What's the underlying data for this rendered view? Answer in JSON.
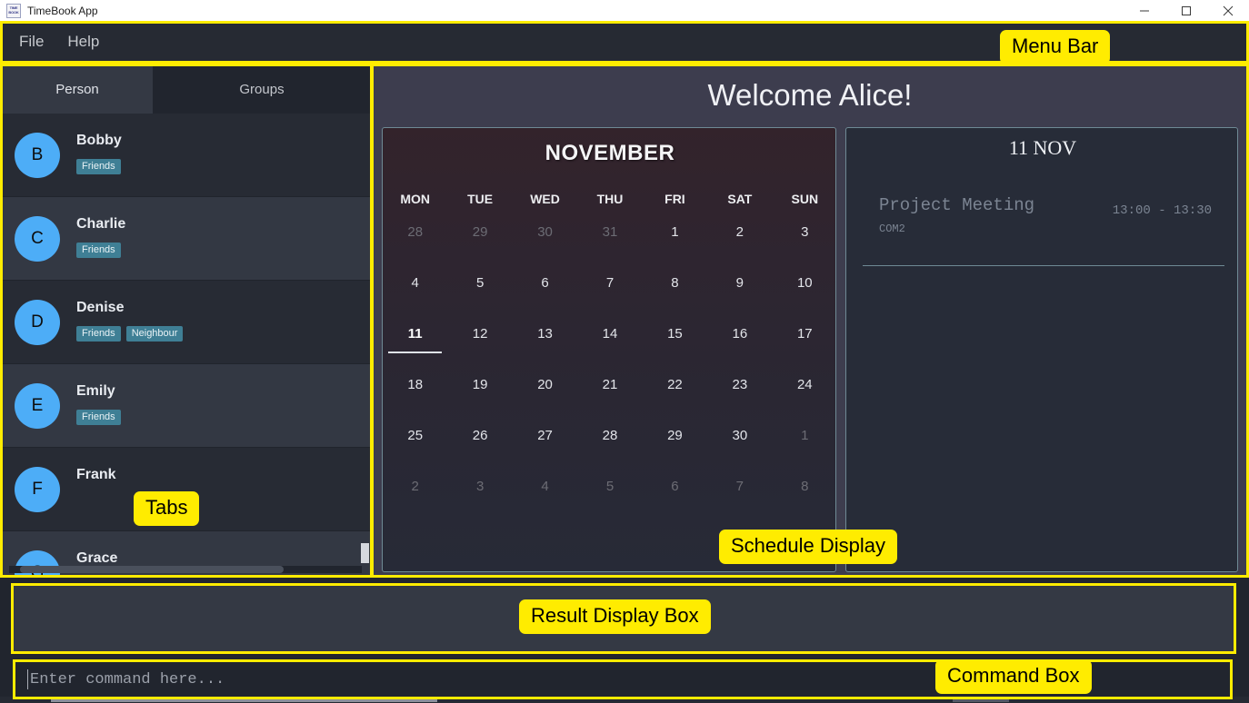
{
  "window": {
    "title": "TimeBook App",
    "icon_line1": "TIME",
    "icon_line2": "BOOK",
    "controls": {
      "minimize": "minimize-icon",
      "maximize": "maximize-icon",
      "close": "close-icon"
    }
  },
  "menubar": {
    "items": [
      {
        "label": "File"
      },
      {
        "label": "Help"
      }
    ]
  },
  "tabs": {
    "items": [
      {
        "label": "Person",
        "active": true
      },
      {
        "label": "Groups",
        "active": false
      }
    ]
  },
  "person_list": [
    {
      "initial": "B",
      "name": "Bobby",
      "tags": [
        "Friends"
      ]
    },
    {
      "initial": "C",
      "name": "Charlie",
      "tags": [
        "Friends"
      ]
    },
    {
      "initial": "D",
      "name": "Denise",
      "tags": [
        "Friends",
        "Neighbour"
      ]
    },
    {
      "initial": "E",
      "name": "Emily",
      "tags": [
        "Friends"
      ]
    },
    {
      "initial": "F",
      "name": "Frank",
      "tags": []
    },
    {
      "initial": "G",
      "name": "Grace",
      "tags": []
    }
  ],
  "main": {
    "welcome": "Welcome Alice!"
  },
  "calendar": {
    "month": "NOVEMBER",
    "day_headers": [
      "MON",
      "TUE",
      "WED",
      "THU",
      "FRI",
      "SAT",
      "SUN"
    ],
    "selected_day": 11,
    "weeks": [
      [
        {
          "d": "28",
          "o": true
        },
        {
          "d": "29",
          "o": true
        },
        {
          "d": "30",
          "o": true
        },
        {
          "d": "31",
          "o": true
        },
        {
          "d": "1",
          "o": false
        },
        {
          "d": "2",
          "o": false
        },
        {
          "d": "3",
          "o": false
        }
      ],
      [
        {
          "d": "4",
          "o": false
        },
        {
          "d": "5",
          "o": false
        },
        {
          "d": "6",
          "o": false
        },
        {
          "d": "7",
          "o": false
        },
        {
          "d": "8",
          "o": false
        },
        {
          "d": "9",
          "o": false
        },
        {
          "d": "10",
          "o": false
        }
      ],
      [
        {
          "d": "11",
          "o": false,
          "sel": true
        },
        {
          "d": "12",
          "o": false
        },
        {
          "d": "13",
          "o": false
        },
        {
          "d": "14",
          "o": false
        },
        {
          "d": "15",
          "o": false
        },
        {
          "d": "16",
          "o": false
        },
        {
          "d": "17",
          "o": false
        }
      ],
      [
        {
          "d": "18",
          "o": false
        },
        {
          "d": "19",
          "o": false
        },
        {
          "d": "20",
          "o": false
        },
        {
          "d": "21",
          "o": false
        },
        {
          "d": "22",
          "o": false
        },
        {
          "d": "23",
          "o": false
        },
        {
          "d": "24",
          "o": false
        }
      ],
      [
        {
          "d": "25",
          "o": false
        },
        {
          "d": "26",
          "o": false
        },
        {
          "d": "27",
          "o": false
        },
        {
          "d": "28",
          "o": false
        },
        {
          "d": "29",
          "o": false
        },
        {
          "d": "30",
          "o": false
        },
        {
          "d": "1",
          "o": true
        }
      ],
      [
        {
          "d": "2",
          "o": true
        },
        {
          "d": "3",
          "o": true
        },
        {
          "d": "4",
          "o": true
        },
        {
          "d": "5",
          "o": true
        },
        {
          "d": "6",
          "o": true
        },
        {
          "d": "7",
          "o": true
        },
        {
          "d": "8",
          "o": true
        }
      ]
    ]
  },
  "schedule": {
    "date_title": "11 NOV",
    "events": [
      {
        "name": "Project Meeting",
        "location": "COM2",
        "time": "13:00 - 13:30"
      }
    ]
  },
  "result_box": {
    "text": ""
  },
  "command_box": {
    "value": "",
    "placeholder": "Enter command here..."
  },
  "annotations": [
    {
      "label": "Menu Bar"
    },
    {
      "label": "Tabs"
    },
    {
      "label": "Schedule Display"
    },
    {
      "label": "Result Display Box"
    },
    {
      "label": "Command Box"
    }
  ],
  "colors": {
    "accent_yellow": "#ffec00",
    "avatar_blue": "#4dadf7",
    "tag_teal": "#3f7f95",
    "panel_border": "#6f8a95",
    "header_slate": "#3d3d4e"
  }
}
